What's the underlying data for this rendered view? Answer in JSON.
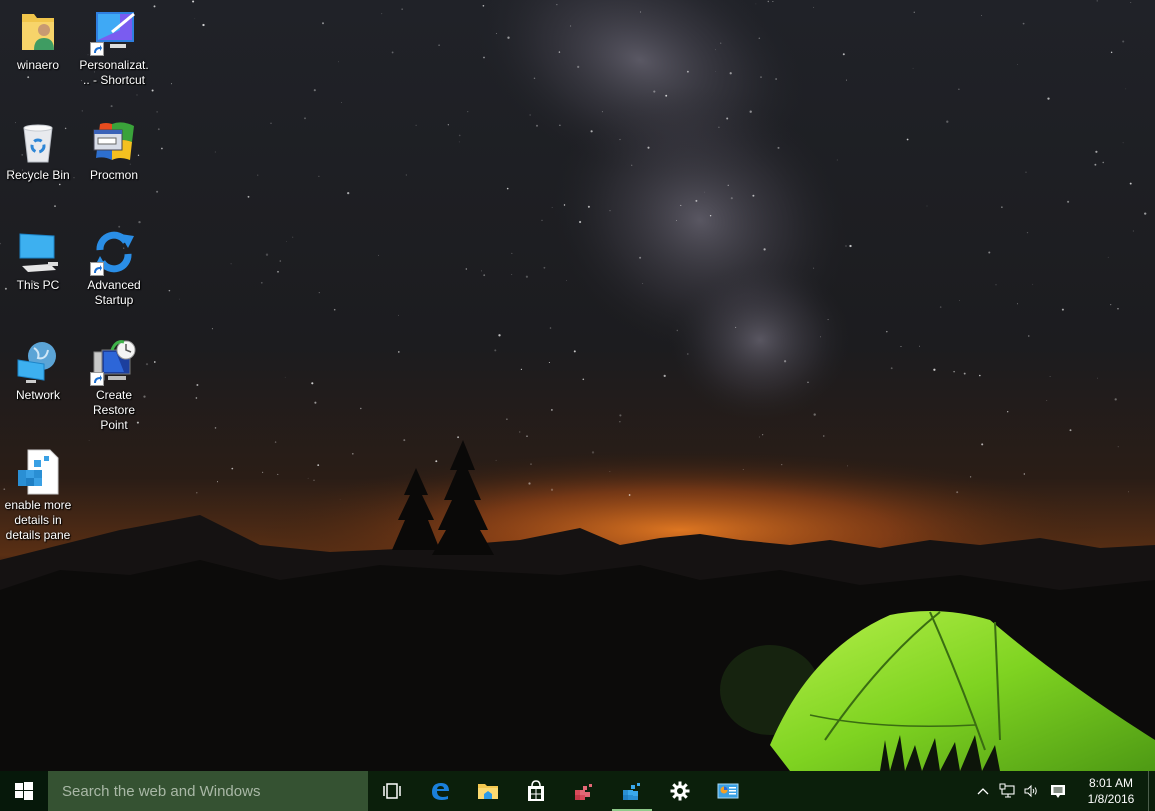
{
  "desktop": {
    "icons": [
      {
        "label": "winaero",
        "icon": "user-folder-icon",
        "shortcut": false
      },
      {
        "label": "Personalizat... - Shortcut",
        "icon": "personalization-icon",
        "shortcut": true
      },
      {
        "label": "Recycle Bin",
        "icon": "recycle-bin-icon",
        "shortcut": false
      },
      {
        "label": "Procmon",
        "icon": "procmon-icon",
        "shortcut": false
      },
      {
        "label": "This PC",
        "icon": "computer-icon",
        "shortcut": false
      },
      {
        "label": "Advanced Startup",
        "icon": "refresh-arrows-icon",
        "shortcut": true
      },
      {
        "label": "Network",
        "icon": "network-globe-icon",
        "shortcut": false
      },
      {
        "label": "Create Restore Point",
        "icon": "system-restore-icon",
        "shortcut": true
      },
      {
        "label": "enable more details in details pane",
        "icon": "registry-file-icon",
        "shortcut": false
      }
    ]
  },
  "taskbar": {
    "start_icon": "windows-logo-icon",
    "search_placeholder": "Search the web and Windows",
    "pinned": [
      {
        "name": "task-view",
        "icon": "task-view-icon",
        "active": false
      },
      {
        "name": "edge",
        "icon": "edge-browser-icon",
        "active": false
      },
      {
        "name": "file-explorer",
        "icon": "file-explorer-icon",
        "active": false
      },
      {
        "name": "store",
        "icon": "store-icon",
        "active": false
      },
      {
        "name": "registry-app-red",
        "icon": "registry-cubes-red-icon",
        "active": false
      },
      {
        "name": "registry-editor",
        "icon": "registry-cubes-blue-icon",
        "active": true
      },
      {
        "name": "settings",
        "icon": "gear-icon",
        "active": false
      },
      {
        "name": "control-panel",
        "icon": "control-panel-icon",
        "active": false
      }
    ],
    "tray": {
      "icons": [
        "chevron-up-icon",
        "network-icon",
        "volume-icon",
        "action-center-icon"
      ],
      "time": "8:01 AM",
      "date": "1/8/2016"
    }
  },
  "colors": {
    "taskbar_bg": "#0b1f0b",
    "search_bg": "#355232",
    "active_indicator": "#8fc98a",
    "tent_green": "#7fd321",
    "horizon_orange": "#e07320"
  }
}
